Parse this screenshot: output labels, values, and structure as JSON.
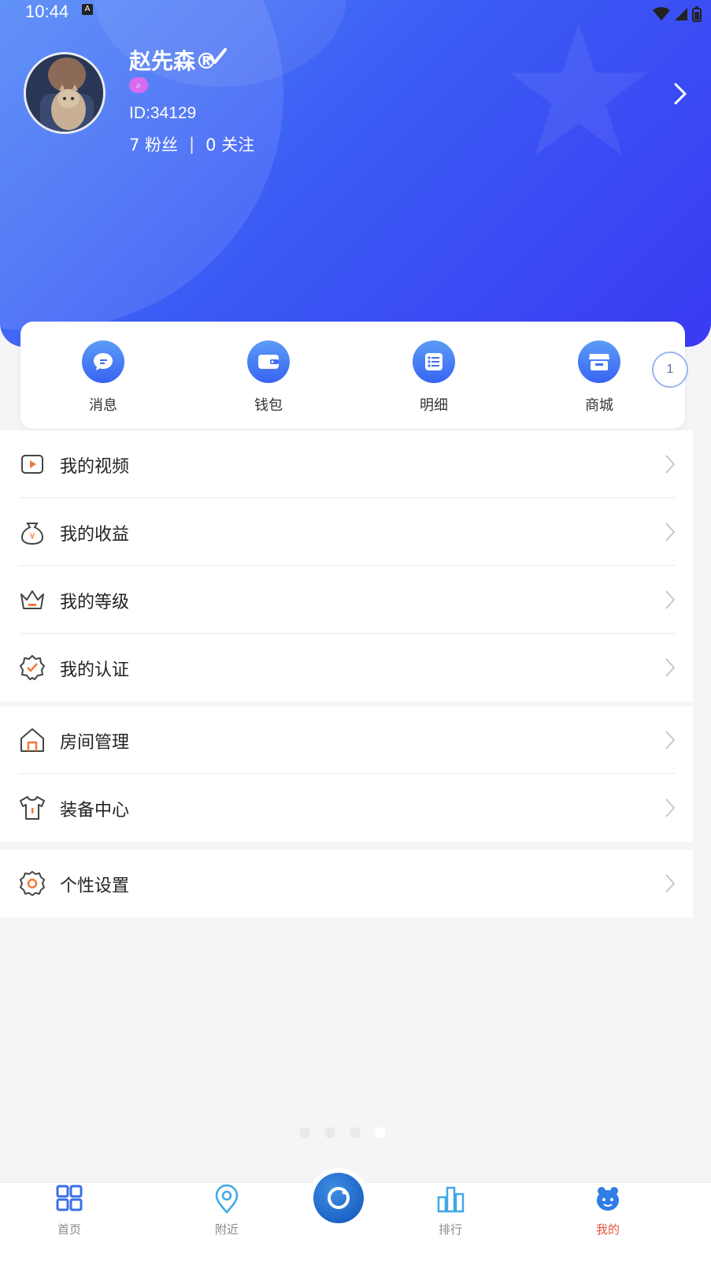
{
  "status_bar": {
    "time": "10:44",
    "notification_letter": "A"
  },
  "profile": {
    "name": "赵先森®",
    "id": "ID:34129",
    "fans_count": "7 粉丝",
    "separator": "|",
    "follow_count": "0 关注"
  },
  "quick_actions": [
    {
      "label": "消息",
      "icon": "message-icon"
    },
    {
      "label": "钱包",
      "icon": "wallet-icon"
    },
    {
      "label": "明细",
      "icon": "list-detail-icon"
    },
    {
      "label": "商城",
      "icon": "store-icon"
    }
  ],
  "floating_badge": "1",
  "menu": {
    "group1": [
      {
        "label": "我的视频",
        "icon": "video-icon"
      },
      {
        "label": "我的收益",
        "icon": "money-bag-icon"
      },
      {
        "label": "我的等级",
        "icon": "crown-icon"
      },
      {
        "label": "我的认证",
        "icon": "certified-icon"
      }
    ],
    "group2": [
      {
        "label": "房间管理",
        "icon": "house-icon"
      },
      {
        "label": "装备中心",
        "icon": "shirt-icon"
      }
    ],
    "group3": [
      {
        "label": "个性设置",
        "icon": "gear-icon"
      }
    ]
  },
  "page_indicator": {
    "count": 4,
    "active_index": 3
  },
  "tabbar": {
    "items": [
      {
        "label": "首页",
        "icon": "grid-icon"
      },
      {
        "label": "附近",
        "icon": "location-icon"
      },
      {
        "label": "排行",
        "icon": "chart-icon"
      },
      {
        "label": "我的",
        "icon": "profile-icon"
      }
    ],
    "active_index": 3
  },
  "colors": {
    "primary": "#3b5cf5",
    "accent_active": "#e5533f",
    "menu_icon_orange": "#f07a3a"
  }
}
